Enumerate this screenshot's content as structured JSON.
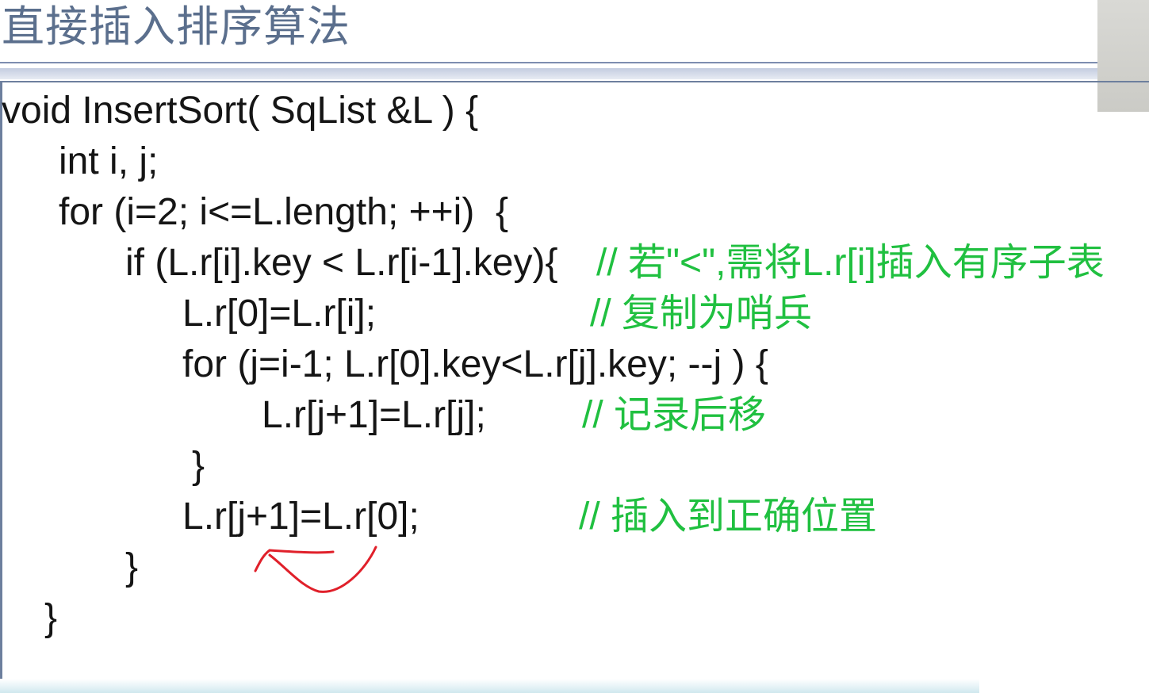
{
  "slide": {
    "title": "直接插入排序算法"
  },
  "code": {
    "lines": [
      "void InsertSort( SqList &L ) {",
      "int i, j;",
      "for (i=2; i<=L.length; ++i)  {",
      "if (L.r[i].key < L.r[i-1].key){",
      "L.r[0]=L.r[i];",
      "for (j=i-1; L.r[0].key<L.r[j].key; --j ) {",
      "L.r[j+1]=L.r[j];",
      "}",
      "L.r[j+1]=L.r[0];",
      "}",
      "}"
    ],
    "comments": {
      "if": "// 若\"<\",需将L.r[i]插入有序子表",
      "sentinel": "// 复制为哨兵",
      "shift": "// 记录后移",
      "insert": "// 插入到正确位置"
    }
  },
  "colors": {
    "title": "#5b6f8d",
    "code": "#151515",
    "comment": "#20c040",
    "annotation": "#e0202a"
  }
}
